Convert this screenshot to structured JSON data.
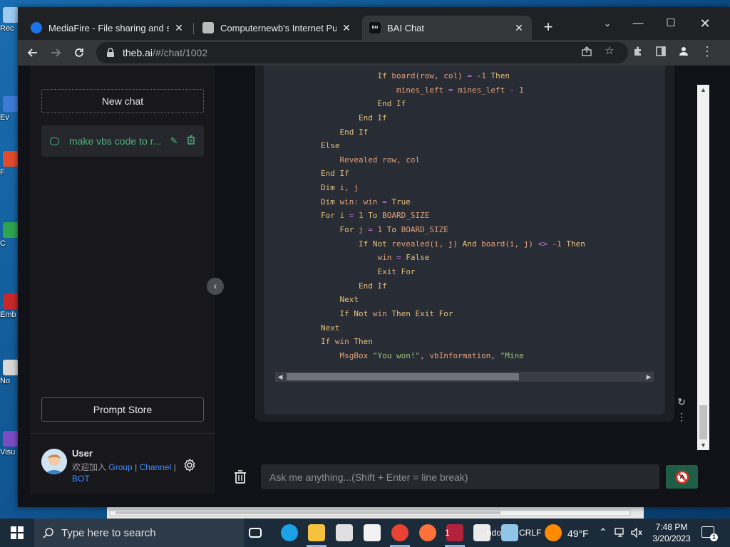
{
  "desktop": {
    "icons": [
      {
        "label": "Rec",
        "color": "#9ec9f0"
      },
      {
        "label": "Ev",
        "color": "#3f7bd6"
      },
      {
        "label": "F",
        "color": "#e24a2b"
      },
      {
        "label": "C",
        "color": "#2da44e"
      },
      {
        "label": "Emb",
        "color": "#c8282b"
      },
      {
        "label": "No",
        "color": "#d8d8d8"
      },
      {
        "label": "Visu",
        "color": "#7a4cc2"
      }
    ]
  },
  "browser": {
    "tabs": [
      {
        "title": "MediaFire - File sharing and stor",
        "icon": "mediafire-icon",
        "color": "#1a73e8"
      },
      {
        "title": "Computernewb's Internet Pub H",
        "icon": "computernewb-icon",
        "color": "#bbbbbb"
      },
      {
        "title": "BAI Chat",
        "icon": "bai-icon",
        "color": "#111111",
        "badge": "BAI"
      }
    ],
    "new_tab": "+",
    "url_host": "theb.ai",
    "url_path": "/#/chat/1002"
  },
  "app": {
    "new_chat_label": "New chat",
    "chat_items": [
      {
        "label": "make vbs code to r..."
      }
    ],
    "prompt_store_label": "Prompt Store",
    "user": {
      "name": "User",
      "prefix": "欢迎加入",
      "link_group": "Group",
      "sep1": "|",
      "link_channel": "Channel",
      "sep2": "|",
      "link_bot": "BOT"
    },
    "composer_placeholder": "Ask me anything...(Shift + Enter = line break)",
    "accent_color": "#4bb07a"
  },
  "code": {
    "lines": [
      [
        {
          "t": "            ",
          "c": ""
        },
        {
          "t": "If",
          "c": "kw"
        },
        {
          "t": " board(row, col) ",
          "c": "id"
        },
        {
          "t": "=",
          "c": "op"
        },
        {
          "t": " ",
          "c": ""
        },
        {
          "t": "-1",
          "c": "id"
        },
        {
          "t": " ",
          "c": ""
        },
        {
          "t": "Then",
          "c": "kw"
        }
      ],
      [
        {
          "t": "                ",
          "c": ""
        },
        {
          "t": "mines_left ",
          "c": "id"
        },
        {
          "t": "=",
          "c": "op"
        },
        {
          "t": " mines_left ",
          "c": "id"
        },
        {
          "t": "-",
          "c": "op"
        },
        {
          "t": " 1",
          "c": "id"
        }
      ],
      [
        {
          "t": "            ",
          "c": ""
        },
        {
          "t": "End If",
          "c": "kw"
        }
      ],
      [
        {
          "t": "        ",
          "c": ""
        },
        {
          "t": "End If",
          "c": "kw"
        }
      ],
      [
        {
          "t": "    ",
          "c": ""
        },
        {
          "t": "End If",
          "c": "kw"
        }
      ],
      [
        {
          "t": "Else",
          "c": "kw"
        }
      ],
      [
        {
          "t": "    ",
          "c": ""
        },
        {
          "t": "Revealed row, col",
          "c": "id"
        }
      ],
      [
        {
          "t": "End If",
          "c": "kw"
        }
      ],
      [
        {
          "t": "Dim",
          "c": "kw"
        },
        {
          "t": " i, j",
          "c": "id"
        }
      ],
      [
        {
          "t": "Dim",
          "c": "kw"
        },
        {
          "t": " win: win ",
          "c": "id"
        },
        {
          "t": "=",
          "c": "op"
        },
        {
          "t": " ",
          "c": ""
        },
        {
          "t": "True",
          "c": "kw"
        }
      ],
      [
        {
          "t": "For",
          "c": "kw"
        },
        {
          "t": " i ",
          "c": "id"
        },
        {
          "t": "=",
          "c": "op"
        },
        {
          "t": " 1 ",
          "c": "id"
        },
        {
          "t": "To",
          "c": "kw"
        },
        {
          "t": " BOARD_SIZE",
          "c": "id"
        }
      ],
      [
        {
          "t": "    ",
          "c": ""
        },
        {
          "t": "For",
          "c": "kw"
        },
        {
          "t": " j ",
          "c": "id"
        },
        {
          "t": "=",
          "c": "op"
        },
        {
          "t": " 1 ",
          "c": "id"
        },
        {
          "t": "To",
          "c": "kw"
        },
        {
          "t": " BOARD_SIZE",
          "c": "id"
        }
      ],
      [
        {
          "t": "        ",
          "c": ""
        },
        {
          "t": "If Not",
          "c": "kw"
        },
        {
          "t": " revealed(i, j) ",
          "c": "id"
        },
        {
          "t": "And",
          "c": "kw"
        },
        {
          "t": " board(i, j) ",
          "c": "id"
        },
        {
          "t": "<>",
          "c": "op"
        },
        {
          "t": " ",
          "c": ""
        },
        {
          "t": "-1",
          "c": "id"
        },
        {
          "t": " ",
          "c": ""
        },
        {
          "t": "Then",
          "c": "kw"
        }
      ],
      [
        {
          "t": "            ",
          "c": ""
        },
        {
          "t": "win ",
          "c": "id"
        },
        {
          "t": "=",
          "c": "op"
        },
        {
          "t": " ",
          "c": ""
        },
        {
          "t": "False",
          "c": "kw"
        }
      ],
      [
        {
          "t": "            ",
          "c": ""
        },
        {
          "t": "Exit For",
          "c": "kw"
        }
      ],
      [
        {
          "t": "        ",
          "c": ""
        },
        {
          "t": "End If",
          "c": "kw"
        }
      ],
      [
        {
          "t": "    ",
          "c": ""
        },
        {
          "t": "Next",
          "c": "kw"
        }
      ],
      [
        {
          "t": "    ",
          "c": ""
        },
        {
          "t": "If Not",
          "c": "kw"
        },
        {
          "t": " win ",
          "c": "id"
        },
        {
          "t": "Then",
          "c": "kw"
        },
        {
          "t": " ",
          "c": ""
        },
        {
          "t": "Exit For",
          "c": "kw"
        }
      ],
      [
        {
          "t": "Next",
          "c": "kw"
        }
      ],
      [
        {
          "t": "If",
          "c": "kw"
        },
        {
          "t": " win ",
          "c": "id"
        },
        {
          "t": "Then",
          "c": "kw"
        }
      ],
      [
        {
          "t": "    ",
          "c": ""
        },
        {
          "t": "MsgBox ",
          "c": "id"
        },
        {
          "t": "\"You won!\"",
          "c": "str"
        },
        {
          "t": ", vbInformation, ",
          "c": "id"
        },
        {
          "t": "\"Mine",
          "c": "str"
        }
      ]
    ]
  },
  "taskbar": {
    "search_placeholder": "Type here to search",
    "temperature": "49°F",
    "time": "7:48 PM",
    "date": "3/20/2023",
    "notifications": "1",
    "apps": [
      {
        "name": "task-view-icon",
        "color": "#ffffff"
      },
      {
        "name": "edge-icon",
        "color": "#1aa1e6"
      },
      {
        "name": "file-explorer-icon",
        "color": "#f4c23d"
      },
      {
        "name": "store-icon",
        "color": "#e0e0e0"
      },
      {
        "name": "mail-icon",
        "color": "#f2f2f2"
      },
      {
        "name": "chrome-icon",
        "color": "#ea4335"
      },
      {
        "name": "firefox-icon",
        "color": "#ff7139"
      },
      {
        "name": "winrar-icon",
        "color": "#b3223d"
      },
      {
        "name": "vscode-icon",
        "color": "#eaeaea"
      },
      {
        "name": "notepad-icon",
        "color": "#8fc6e8"
      },
      {
        "name": "weather-icon",
        "color": "#ff8a00"
      }
    ],
    "bg_text_1": "1",
    "bg_text_2": "ndo",
    "bg_text_3": "CRLF"
  }
}
